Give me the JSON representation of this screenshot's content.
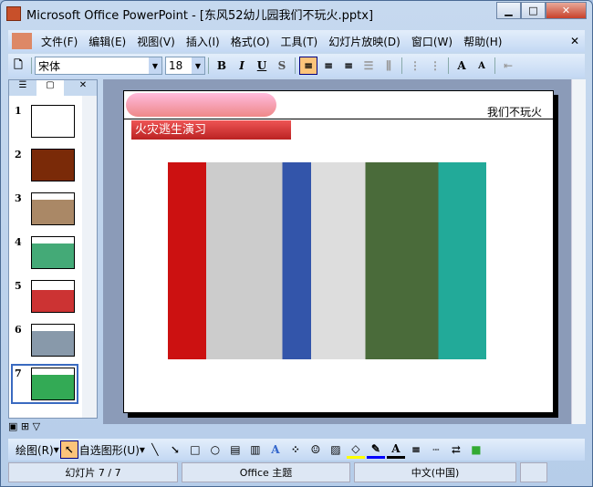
{
  "title": "Microsoft Office PowerPoint - [东风52幼儿园我们不玩火.pptx]",
  "menu": [
    "文件(F)",
    "编辑(E)",
    "视图(V)",
    "插入(I)",
    "格式(O)",
    "工具(T)",
    "幻灯片放映(D)",
    "窗口(W)",
    "帮助(H)"
  ],
  "toolbar": {
    "font": "宋体",
    "size": "18",
    "bold": "B",
    "italic": "I",
    "underline": "U",
    "shadow": "S"
  },
  "slides": [
    "1",
    "2",
    "3",
    "4",
    "5",
    "6",
    "7"
  ],
  "slide": {
    "header": "我们不玩火",
    "title": "火灾逃生演习"
  },
  "draw": {
    "draw": "绘图(R)",
    "autoshapes": "自选图形(U)"
  },
  "status": {
    "slide": "幻灯片 7 / 7",
    "theme": "Office 主题",
    "lang": "中文(中国)"
  }
}
